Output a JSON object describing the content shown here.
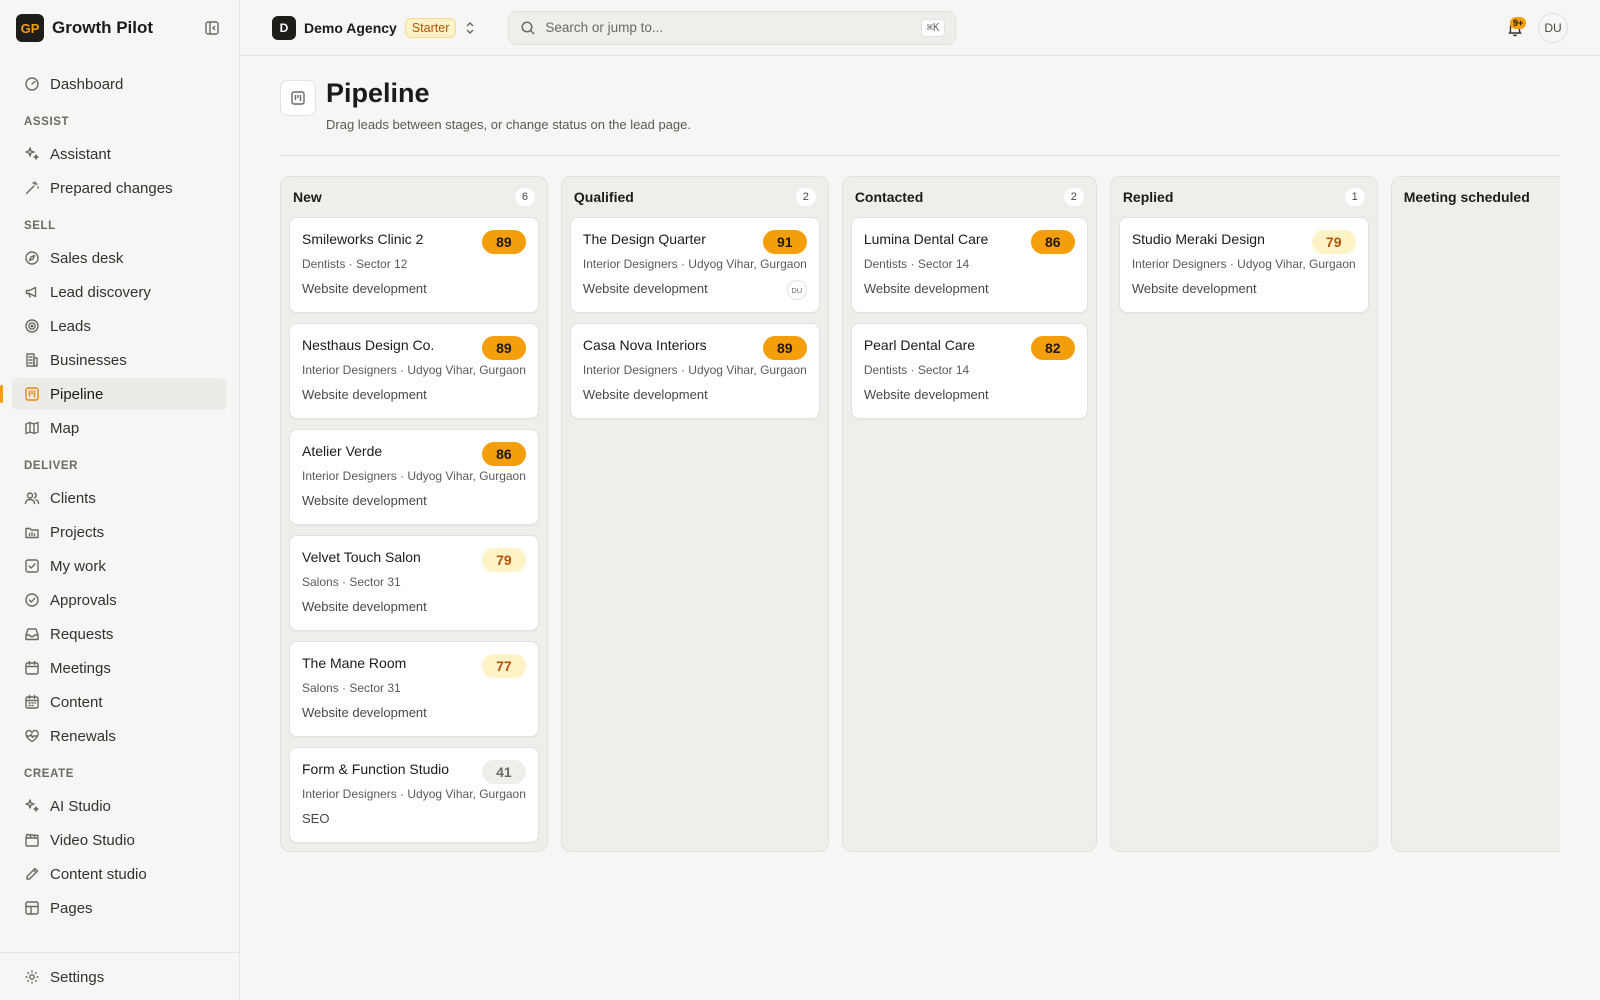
{
  "brand": {
    "logo": "GP",
    "name": "Growth Pilot"
  },
  "sidebar": {
    "top": [
      {
        "label": "Dashboard",
        "icon": "gauge-icon"
      }
    ],
    "sections": [
      {
        "title": "ASSIST",
        "items": [
          {
            "label": "Assistant",
            "icon": "sparkles-icon"
          },
          {
            "label": "Prepared changes",
            "icon": "wand-icon"
          }
        ]
      },
      {
        "title": "SELL",
        "items": [
          {
            "label": "Sales desk",
            "icon": "compass-icon"
          },
          {
            "label": "Lead discovery",
            "icon": "megaphone-icon"
          },
          {
            "label": "Leads",
            "icon": "target-icon"
          },
          {
            "label": "Businesses",
            "icon": "building-icon"
          },
          {
            "label": "Pipeline",
            "icon": "kanban-icon",
            "active": true
          },
          {
            "label": "Map",
            "icon": "map-icon"
          }
        ]
      },
      {
        "title": "DELIVER",
        "items": [
          {
            "label": "Clients",
            "icon": "users-icon"
          },
          {
            "label": "Projects",
            "icon": "folder-icon"
          },
          {
            "label": "My work",
            "icon": "check-square-icon"
          },
          {
            "label": "Approvals",
            "icon": "check-circle-icon"
          },
          {
            "label": "Requests",
            "icon": "inbox-icon"
          },
          {
            "label": "Meetings",
            "icon": "calendar-icon"
          },
          {
            "label": "Content",
            "icon": "calendar-days-icon"
          },
          {
            "label": "Renewals",
            "icon": "heart-pulse-icon"
          }
        ]
      },
      {
        "title": "CREATE",
        "items": [
          {
            "label": "AI Studio",
            "icon": "sparkles-icon"
          },
          {
            "label": "Video Studio",
            "icon": "clapperboard-icon"
          },
          {
            "label": "Content studio",
            "icon": "pen-icon"
          },
          {
            "label": "Pages",
            "icon": "layout-icon"
          }
        ]
      }
    ],
    "footer": {
      "label": "Settings",
      "icon": "gear-icon"
    }
  },
  "topbar": {
    "workspace_initial": "D",
    "workspace_name": "Demo Agency",
    "plan": "Starter",
    "search_placeholder": "Search or jump to...",
    "search_shortcut": "⌘K",
    "notifications_badge": "9+",
    "user_initials": "DU"
  },
  "page": {
    "title": "Pipeline",
    "subtitle": "Drag leads between stages, or change status on the lead page."
  },
  "colors": {
    "accent": "#f59e0b",
    "warm_bg": "#fef3c7",
    "warm_text": "#b45309"
  },
  "columns": [
    {
      "title": "New",
      "count": "6",
      "cards": [
        {
          "name": "Smileworks Clinic 2",
          "score": "89",
          "level": "hot",
          "meta": "Dentists · Sector 12",
          "service": "Website development"
        },
        {
          "name": "Nesthaus Design Co.",
          "score": "89",
          "level": "hot",
          "meta": "Interior Designers · Udyog Vihar, Gurgaon",
          "service": "Website development"
        },
        {
          "name": "Atelier Verde",
          "score": "86",
          "level": "hot",
          "meta": "Interior Designers · Udyog Vihar, Gurgaon",
          "service": "Website development"
        },
        {
          "name": "Velvet Touch Salon",
          "score": "79",
          "level": "warm",
          "meta": "Salons · Sector 31",
          "service": "Website development"
        },
        {
          "name": "The Mane Room",
          "score": "77",
          "level": "warm",
          "meta": "Salons · Sector 31",
          "service": "Website development"
        },
        {
          "name": "Form & Function Studio",
          "score": "41",
          "level": "cold",
          "meta": "Interior Designers · Udyog Vihar, Gurgaon",
          "service": "SEO"
        }
      ]
    },
    {
      "title": "Qualified",
      "count": "2",
      "cards": [
        {
          "name": "The Design Quarter",
          "score": "91",
          "level": "hot",
          "meta": "Interior Designers · Udyog Vihar, Gurgaon",
          "service": "Website development",
          "assignee": "DU"
        },
        {
          "name": "Casa Nova Interiors",
          "score": "89",
          "level": "hot",
          "meta": "Interior Designers · Udyog Vihar, Gurgaon",
          "service": "Website development"
        }
      ]
    },
    {
      "title": "Contacted",
      "count": "2",
      "cards": [
        {
          "name": "Lumina Dental Care",
          "score": "86",
          "level": "hot",
          "meta": "Dentists · Sector 14",
          "service": "Website development"
        },
        {
          "name": "Pearl Dental Care",
          "score": "82",
          "level": "hot",
          "meta": "Dentists · Sector 14",
          "service": "Website development"
        }
      ]
    },
    {
      "title": "Replied",
      "count": "1",
      "cards": [
        {
          "name": "Studio Meraki Design",
          "score": "79",
          "level": "warm",
          "meta": "Interior Designers · Udyog Vihar, Gurgaon",
          "service": "Website development"
        }
      ]
    },
    {
      "title": "Meeting scheduled",
      "count": "",
      "cards": []
    }
  ]
}
